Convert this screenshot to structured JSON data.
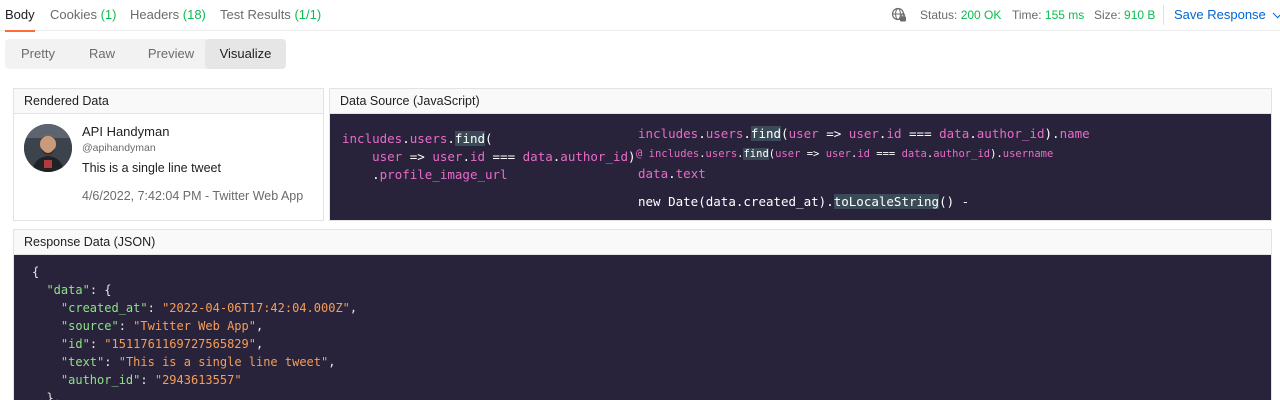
{
  "tabs": {
    "body": "Body",
    "cookies_label": "Cookies",
    "cookies_count": "(1)",
    "headers_label": "Headers",
    "headers_count": "(18)",
    "tests_label": "Test Results",
    "tests_count": "(1/1)"
  },
  "status": {
    "status_label": "Status:",
    "status_value": "200 OK",
    "time_label": "Time:",
    "time_value": "155 ms",
    "size_label": "Size:",
    "size_value": "910 B",
    "save_label": "Save Response"
  },
  "modes": {
    "pretty": "Pretty",
    "raw": "Raw",
    "preview": "Preview",
    "visualize": "Visualize"
  },
  "rendered": {
    "title": "Rendered Data",
    "name": "API Handyman",
    "handle": "@apihandyman",
    "text": "This is a single line tweet",
    "meta": "4/6/2022, 7:42:04 PM - Twitter Web App"
  },
  "datasource": {
    "title": "Data Source (JavaScript)",
    "left_lines": [
      "includes.users.find(",
      "    user => user.id === data.author_id)",
      "    .profile_image_url"
    ],
    "right_lines": [
      "includes.users.find(user => user.id === data.author_id).name",
      "@ includes.users.find(user => user.id === data.author_id).username",
      "data.text",
      "new Date(data.created_at).toLocaleString() -"
    ]
  },
  "response": {
    "title": "Response Data (JSON)",
    "lines": [
      "{",
      "  \"data\": {",
      "    \"created_at\": \"2022-04-06T17:42:04.000Z\",",
      "    \"source\": \"Twitter Web App\",",
      "    \"id\": \"1511761169727565829\",",
      "    \"text\": \"This is a single line tweet\",",
      "    \"author_id\": \"2943613557\"",
      "  },"
    ]
  },
  "colors": {
    "accent_tab": "#ff6c37",
    "success": "#0cbb52",
    "link": "#0265d2",
    "code_bg": "#28233a",
    "code_pink": "#e96bc9",
    "json_key": "#8fe386",
    "json_string": "#f79d56"
  },
  "icons": {
    "globe": "globe-icon",
    "chevron": "chevron-down-icon"
  }
}
